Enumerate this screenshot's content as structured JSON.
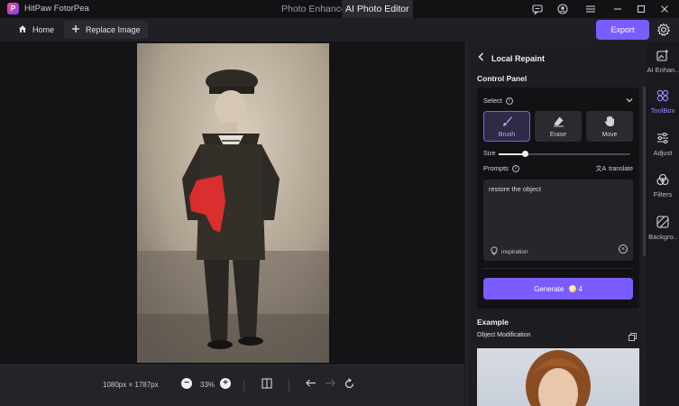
{
  "app": {
    "title": "HitPaw FotorPea"
  },
  "topTabs": [
    {
      "label": "Photo Enhancer",
      "active": false
    },
    {
      "label": "AI Photo Editor",
      "active": true
    }
  ],
  "toolbar": {
    "home": "Home",
    "replace": "Replace Image",
    "export": "Export"
  },
  "canvas": {
    "dimensions": "1080px × 1787px",
    "zoom": "33%"
  },
  "panel": {
    "title": "Local Repaint",
    "controlPanel": "Control Panel",
    "selectLabel": "Select",
    "tools": [
      {
        "label": "Brush",
        "active": true
      },
      {
        "label": "Erase",
        "active": false
      },
      {
        "label": "Move",
        "active": false
      }
    ],
    "sizeLabel": "Size",
    "sizeValue": 0.2,
    "promptsLabel": "Prompts",
    "translate": "translate",
    "promptText": "restore the object",
    "inspiration": "inspiration",
    "generate": "Generate",
    "credits": "4",
    "example": "Example",
    "objectModification": "Object Modification"
  },
  "rail": [
    {
      "label": "AI Enhan..",
      "icon": "ai-enhance-icon",
      "active": false
    },
    {
      "label": "ToolBox",
      "icon": "toolbox-icon",
      "active": true
    },
    {
      "label": "Adjust",
      "icon": "adjust-icon",
      "active": false
    },
    {
      "label": "Filters",
      "icon": "filters-icon",
      "active": false
    },
    {
      "label": "Backgro..",
      "icon": "background-icon",
      "active": false
    }
  ]
}
